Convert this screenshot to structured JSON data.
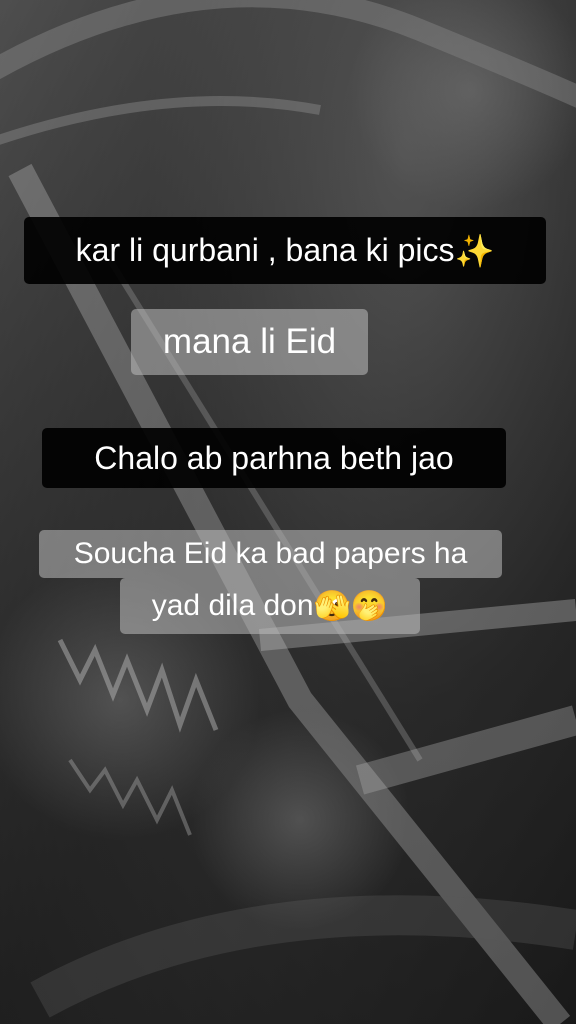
{
  "captions": [
    {
      "text": "kar li qurbani , bana ki pics",
      "emoji": "✨"
    },
    {
      "text": "mana li Eid"
    },
    {
      "text": "Chalo ab parhna beth jao"
    },
    {
      "line1": "Soucha Eid ka bad papers ha",
      "line2": "yad dila don",
      "emoji2": "🫣🤭"
    }
  ],
  "colors": {
    "dark_box": "#000000",
    "light_box": "#bebebe",
    "text": "#ffffff"
  }
}
